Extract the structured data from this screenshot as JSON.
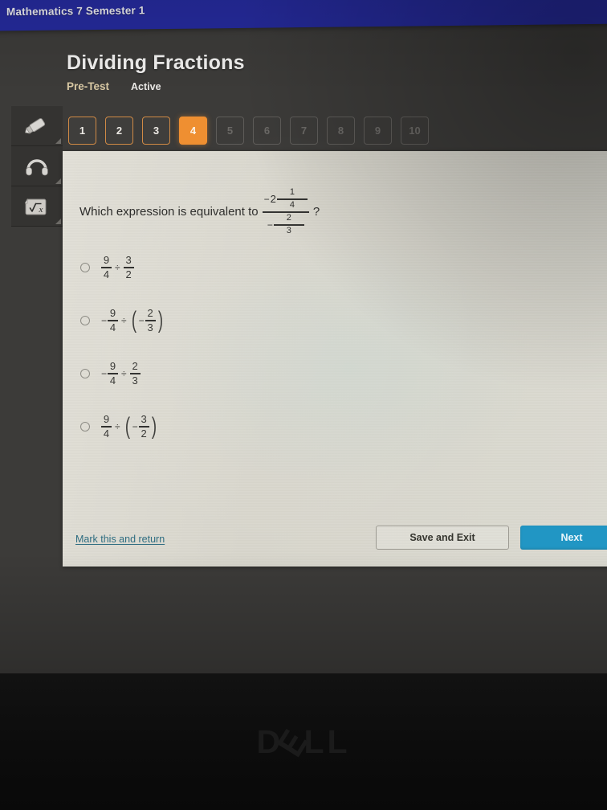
{
  "topbar": {
    "course_title": "Mathematics 7 Semester 1",
    "color": "#252a9b"
  },
  "header": {
    "page_title": "Dividing Fractions",
    "test_type": "Pre-Test",
    "status": "Active",
    "title_color": "#f0efee",
    "test_type_color": "#d9c9a4"
  },
  "toolbar": {
    "tools": [
      {
        "icon": "highlighter-icon",
        "name": "highlighter"
      },
      {
        "icon": "headphones-icon",
        "name": "read-aloud"
      },
      {
        "icon": "square-root-icon",
        "name": "calculator"
      }
    ]
  },
  "question_nav": {
    "active_color": "#ef8f31",
    "completed_border_color": "#d08a45",
    "items": [
      {
        "label": "1",
        "state": "done"
      },
      {
        "label": "2",
        "state": "done"
      },
      {
        "label": "3",
        "state": "done"
      },
      {
        "label": "4",
        "state": "current"
      },
      {
        "label": "5",
        "state": "locked"
      },
      {
        "label": "6",
        "state": "locked"
      },
      {
        "label": "7",
        "state": "locked"
      },
      {
        "label": "8",
        "state": "locked"
      },
      {
        "label": "9",
        "state": "locked"
      },
      {
        "label": "10",
        "state": "locked"
      }
    ]
  },
  "question": {
    "prompt": "Which expression is equivalent to",
    "trailing": "?",
    "complex_fraction": {
      "numerator": {
        "sign": "−",
        "whole": "2",
        "frac_num": "1",
        "frac_den": "4"
      },
      "denominator": {
        "sign": "−",
        "frac_num": "2",
        "frac_den": "3"
      }
    }
  },
  "options": [
    {
      "id": "a",
      "selected": false,
      "left": {
        "sign": "",
        "num": "9",
        "den": "4"
      },
      "operator": "÷",
      "right": {
        "sign": "",
        "num": "3",
        "den": "2",
        "parens": false
      }
    },
    {
      "id": "b",
      "selected": false,
      "left": {
        "sign": "−",
        "num": "9",
        "den": "4"
      },
      "operator": "÷",
      "right": {
        "sign": "−",
        "num": "2",
        "den": "3",
        "parens": true
      }
    },
    {
      "id": "c",
      "selected": false,
      "left": {
        "sign": "−",
        "num": "9",
        "den": "4"
      },
      "operator": "÷",
      "right": {
        "sign": "",
        "num": "2",
        "den": "3",
        "parens": false
      }
    },
    {
      "id": "d",
      "selected": false,
      "left": {
        "sign": "",
        "num": "9",
        "den": "4"
      },
      "operator": "÷",
      "right": {
        "sign": "−",
        "num": "3",
        "den": "2",
        "parens": true
      }
    }
  ],
  "footer": {
    "mark_link": "Mark this and return",
    "mark_link_color": "#2f6d81",
    "save_exit_label": "Save and Exit",
    "next_label": "Next",
    "next_color": "#2196c4"
  },
  "device": {
    "brand": "DELL"
  }
}
